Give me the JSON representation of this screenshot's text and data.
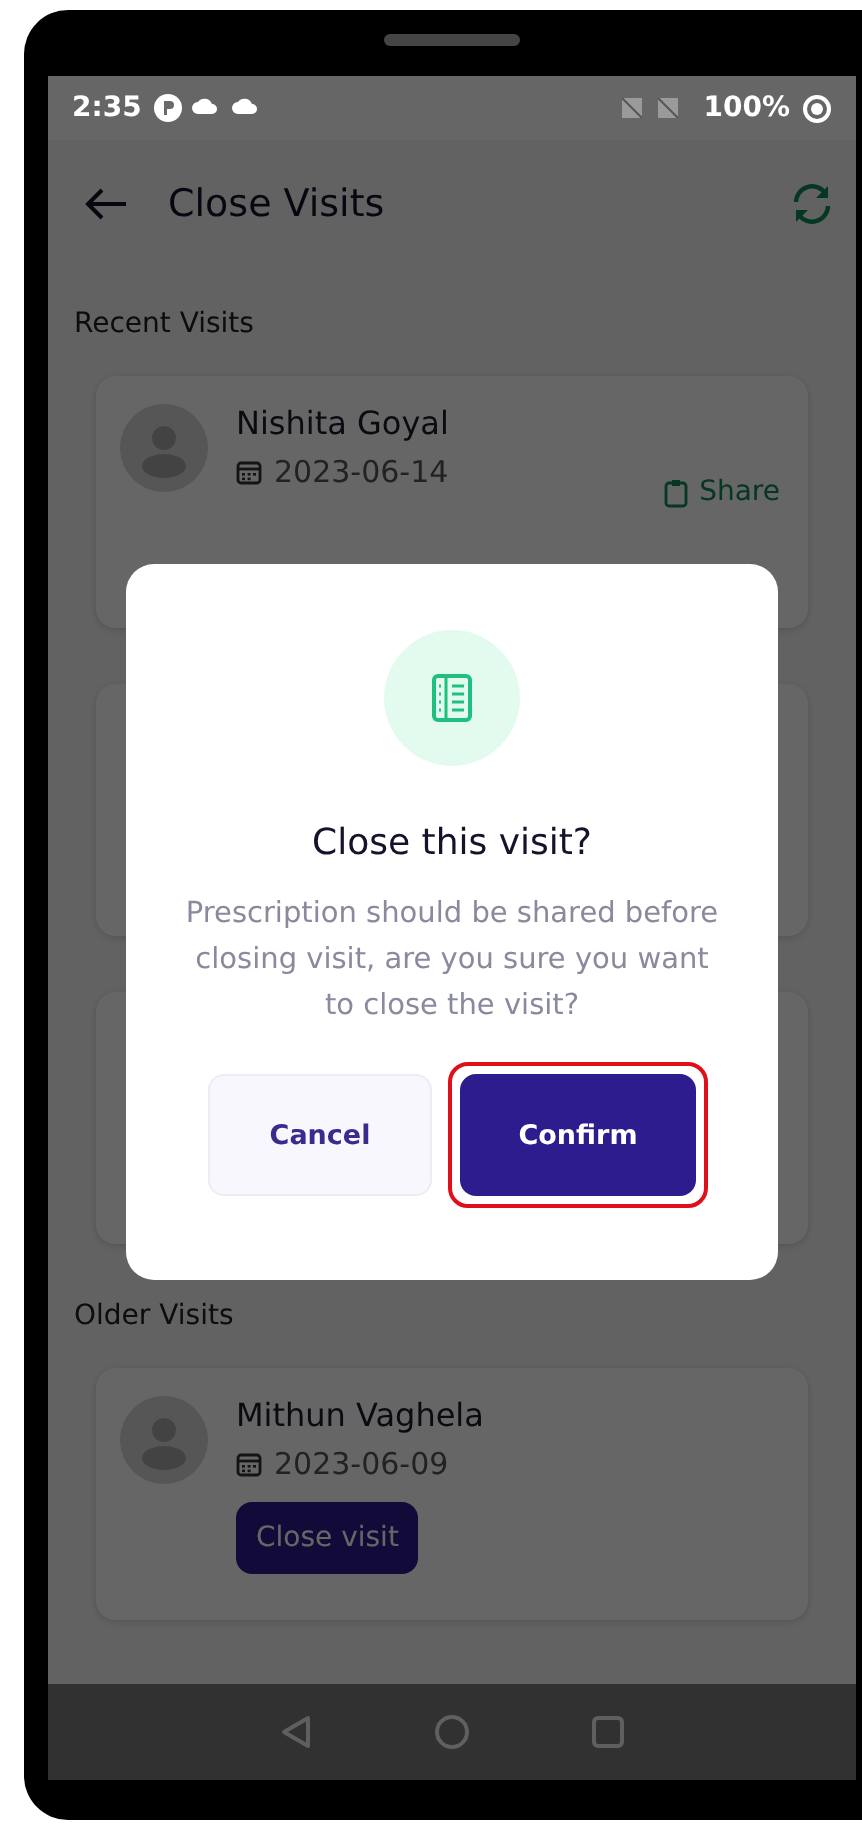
{
  "status_bar": {
    "time": "2:35",
    "battery": "100%"
  },
  "app_bar": {
    "title": "Close Visits"
  },
  "sections": [
    {
      "title": "Recent Visits",
      "cards": [
        {
          "kind": "visit",
          "name": "Nishita Goyal",
          "date": "2023-06-14",
          "action": {
            "kind": "share",
            "label": "Share"
          }
        },
        {
          "kind": "covered"
        },
        {
          "kind": "covered"
        }
      ]
    },
    {
      "title": "Older Visits",
      "cards": [
        {
          "kind": "visit",
          "name": "Mithun Vaghela",
          "date": "2023-06-09",
          "action": {
            "kind": "close",
            "label": "Close visit"
          }
        }
      ]
    }
  ],
  "dialog": {
    "title": "Close this visit?",
    "message": "Prescription should be shared before closing visit, are you sure you want to close the visit?",
    "buttons": [
      {
        "label": "Cancel",
        "kind": "secondary"
      },
      {
        "label": "Confirm",
        "kind": "primary",
        "highlighted": true
      }
    ]
  }
}
